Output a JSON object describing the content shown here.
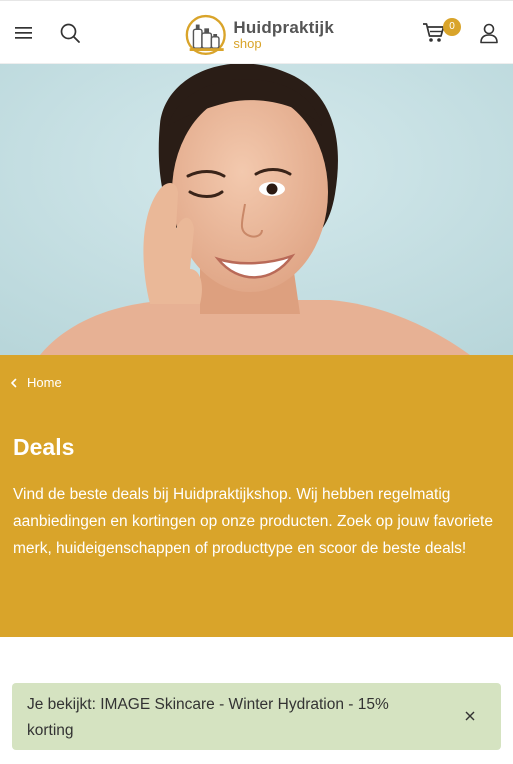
{
  "header": {
    "menu_icon": "hamburger-menu-icon",
    "search_icon": "search-icon",
    "logo": {
      "name": "Huidpraktijk",
      "sub": "shop"
    },
    "cart_icon": "shopping-cart-icon",
    "cart_count": "0",
    "account_icon": "user-icon"
  },
  "colors": {
    "brand_gold": "#d9a42a",
    "notice_bg": "#d5e3c1"
  },
  "hero": {
    "image": "smiling-woman-winking-photo"
  },
  "banner": {
    "breadcrumb": "Home",
    "title": "Deals",
    "description": "Vind de beste deals bij Huidpraktijkshop. Wij hebben regelmatig aanbiedingen en kortingen op onze producten. Zoek op jouw favoriete merk, huideigenschappen of producttype en scoor de beste deals!"
  },
  "filter_notice": {
    "text": "Je bekijkt: IMAGE Skincare - Winter Hydration - 15% korting",
    "close_icon": "close-icon"
  }
}
